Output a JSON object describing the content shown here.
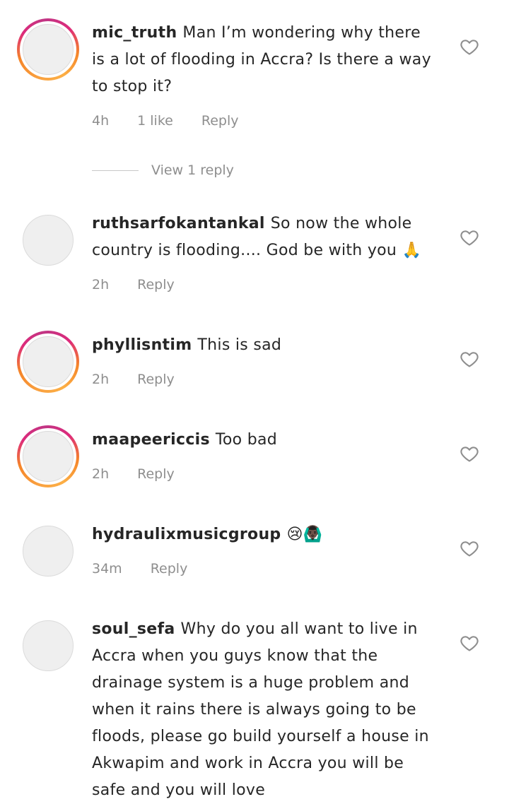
{
  "comments": [
    {
      "username": "mic_truth",
      "text": "Man I’m wondering why there is a lot of flooding in Accra? Is there a way to stop it?",
      "time": "4h",
      "likes": "1 like",
      "reply": "Reply",
      "has_story": true
    },
    {
      "username": "ruthsarfokantankal",
      "text": "So now the whole country is flooding.... God be with you 🙏",
      "time": "2h",
      "reply": "Reply",
      "has_story": false
    },
    {
      "username": "phyllisntim",
      "text": "This is sad",
      "time": "2h",
      "reply": "Reply",
      "has_story": true
    },
    {
      "username": "maapeericcis",
      "text": "Too bad",
      "time": "2h",
      "reply": "Reply",
      "has_story": true
    },
    {
      "username": "hydraulixmusicgroup",
      "text": "😢🙆🏿‍♂️",
      "time": "34m",
      "reply": "Reply",
      "has_story": false
    },
    {
      "username": "soul_sefa",
      "text": "Why do you all want to live in Accra when you guys know  that the drainage system is a huge problem and when it rains there is always going to be floods, please go build yourself a house in Akwapim and work in Accra you will be safe and you will love",
      "has_story": false
    }
  ],
  "view_replies_label": "View 1 reply",
  "icons": {
    "like": "heart-outline-icon"
  },
  "colors": {
    "text": "#262626",
    "secondary": "#8e8e8e",
    "story_ring_start": "#f58529",
    "story_ring_end": "#dd2a7b"
  }
}
